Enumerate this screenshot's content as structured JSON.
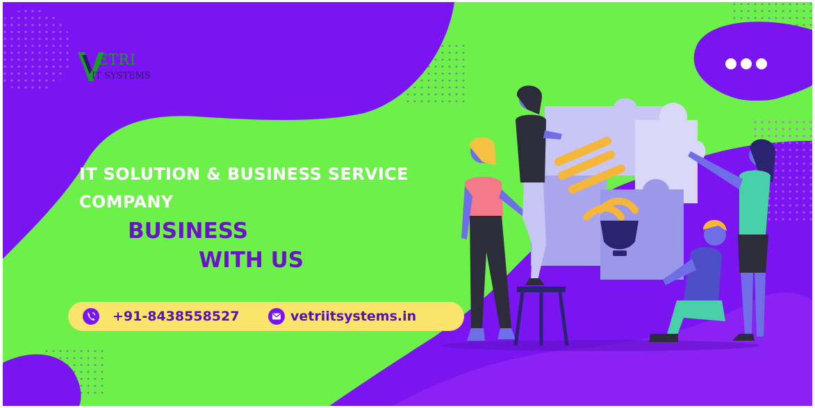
{
  "logo": {
    "line1": "ETRI",
    "line2": "IT SYSTEMS"
  },
  "headline": {
    "line1": "IT SOLUTION & BUSINESS SERVICE",
    "line2": "COMPANY"
  },
  "tagline": {
    "line1": "BUSINESS",
    "line2": "WITH US"
  },
  "contact": {
    "phone": "+91-8438558527",
    "website": "vetriitsystems.in",
    "phone_icon": "phone-icon",
    "email_icon": "email-icon"
  },
  "menu_icon": "more-dots-icon",
  "colors": {
    "purple": "#7a14f0",
    "green": "#6ef04a",
    "yellow": "#fbe46c",
    "deep_purple": "#6a14c8"
  }
}
